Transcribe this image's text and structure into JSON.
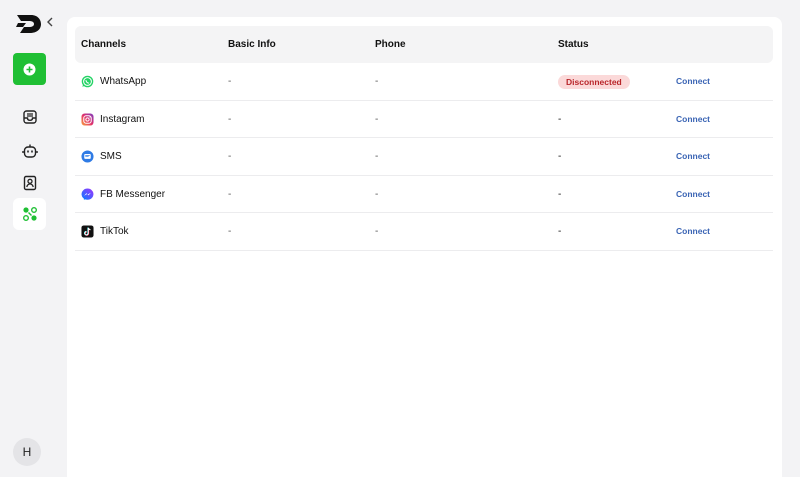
{
  "sidebar": {
    "collapse_glyph": "‹",
    "new_glyph": "+",
    "avatar_initial": "H"
  },
  "table": {
    "headers": {
      "channels": "Channels",
      "basic_info": "Basic Info",
      "phone": "Phone",
      "status": "Status"
    },
    "rows": [
      {
        "channel": "WhatsApp",
        "icon": "whatsapp-icon",
        "basic_info": "-",
        "phone": "-",
        "status": "Disconnected",
        "action": "Connect"
      },
      {
        "channel": "Instagram",
        "icon": "instagram-icon",
        "basic_info": "-",
        "phone": "-",
        "status": "-",
        "action": "Connect"
      },
      {
        "channel": "SMS",
        "icon": "sms-icon",
        "basic_info": "-",
        "phone": "-",
        "status": "-",
        "action": "Connect"
      },
      {
        "channel": "FB Messenger",
        "icon": "messenger-icon",
        "basic_info": "-",
        "phone": "-",
        "status": "-",
        "action": "Connect"
      },
      {
        "channel": "TikTok",
        "icon": "tiktok-icon",
        "basic_info": "-",
        "phone": "-",
        "status": "-",
        "action": "Connect"
      }
    ]
  },
  "colors": {
    "accent_green": "#1fbf34",
    "link_blue": "#3a64b4",
    "danger_bg": "#fbd9d9",
    "danger_text": "#b9262a"
  }
}
